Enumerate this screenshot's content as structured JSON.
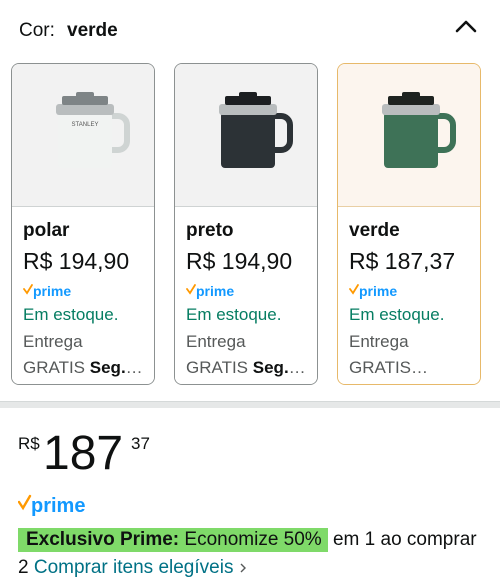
{
  "color_selector": {
    "label": "Cor:",
    "selected": "verde",
    "collapse_icon": "chevron-up-icon"
  },
  "swatches": [
    {
      "name": "polar",
      "price": "R$ 194,90",
      "prime": "prime",
      "stock": "Em estoque.",
      "delivery_line1": "Entrega",
      "delivery_prefix": "GRATIS",
      "delivery_day": "Seg.,…",
      "mug_color": "#f1f3f2",
      "lid_color": "#7e8486"
    },
    {
      "name": "preto",
      "price": "R$ 194,90",
      "prime": "prime",
      "stock": "Em estoque.",
      "delivery_line1": "Entrega",
      "delivery_prefix": "GRATIS",
      "delivery_day": "Seg.,…",
      "mug_color": "#2c3236",
      "lid_color": "#1c1f21"
    },
    {
      "name": "verde",
      "price": "R$ 187,37",
      "prime": "prime",
      "stock": "Em estoque.",
      "delivery_line1": "Entrega",
      "delivery_prefix": "GRATIS…",
      "delivery_day": "",
      "mug_color": "#3e7257",
      "lid_color": "#1e2320"
    }
  ],
  "price": {
    "currency": "R$",
    "whole": "187",
    "fraction": "37"
  },
  "prime_logo": "prime",
  "promo": {
    "badge_bold": "Exclusivo Prime:",
    "badge_text": " Economize 50%",
    "after_badge": " em 1 ao comprar 2 ",
    "link": "Comprar itens elegíveis",
    "link_icon": "chevron-right-icon"
  },
  "colors": {
    "stock_green": "#067d62",
    "link_teal": "#007185",
    "prime_blue": "#1399ff",
    "prime_orange": "#ff9900",
    "promo_badge": "#7fda69",
    "selected_border": "#e7b96a"
  }
}
